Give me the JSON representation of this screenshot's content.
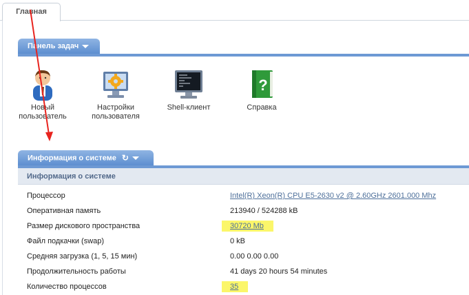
{
  "tabs": {
    "main_label": "Главная"
  },
  "tasks_panel": {
    "title": "Панель задач",
    "items": [
      {
        "label_line1": "Новый",
        "label_line2": "пользователь",
        "icon": "user-add-icon"
      },
      {
        "label_line1": "Настройки",
        "label_line2": "пользователя",
        "icon": "settings-gear-icon"
      },
      {
        "label_line1": "Shell-клиент",
        "label_line2": "",
        "icon": "terminal-icon"
      },
      {
        "label_line1": "Справка",
        "label_line2": "",
        "icon": "help-book-icon"
      }
    ]
  },
  "info_panel": {
    "title": "Информация о системе",
    "table_title": "Информация о системе",
    "rows": [
      {
        "key": "Процессор",
        "value": "Intel(R) Xeon(R) CPU E5-2630 v2 @ 2.60GHz 2601.000 Mhz",
        "link": true,
        "highlight": false
      },
      {
        "key": "Оперативная память",
        "value": "213940 / 524288 kB",
        "link": false,
        "highlight": false
      },
      {
        "key": "Размер дискового пространства",
        "value": "30720 Mb",
        "link": true,
        "highlight": true
      },
      {
        "key": "Файл подкачки (swap)",
        "value": "0 kB",
        "link": false,
        "highlight": false
      },
      {
        "key": "Средняя загрузка (1, 5, 15 мин)",
        "value": "0.00 0.00 0.00",
        "link": false,
        "highlight": false
      },
      {
        "key": "Продолжительность работы",
        "value": "41 days 20 hours 54 minutes",
        "link": false,
        "highlight": false
      },
      {
        "key": "Количество процессов",
        "value": "35",
        "link": true,
        "highlight": true
      }
    ]
  },
  "colors": {
    "panel_blue": "#5b8dcf",
    "highlight": "#fbf66a",
    "arrow": "#e8231e"
  }
}
